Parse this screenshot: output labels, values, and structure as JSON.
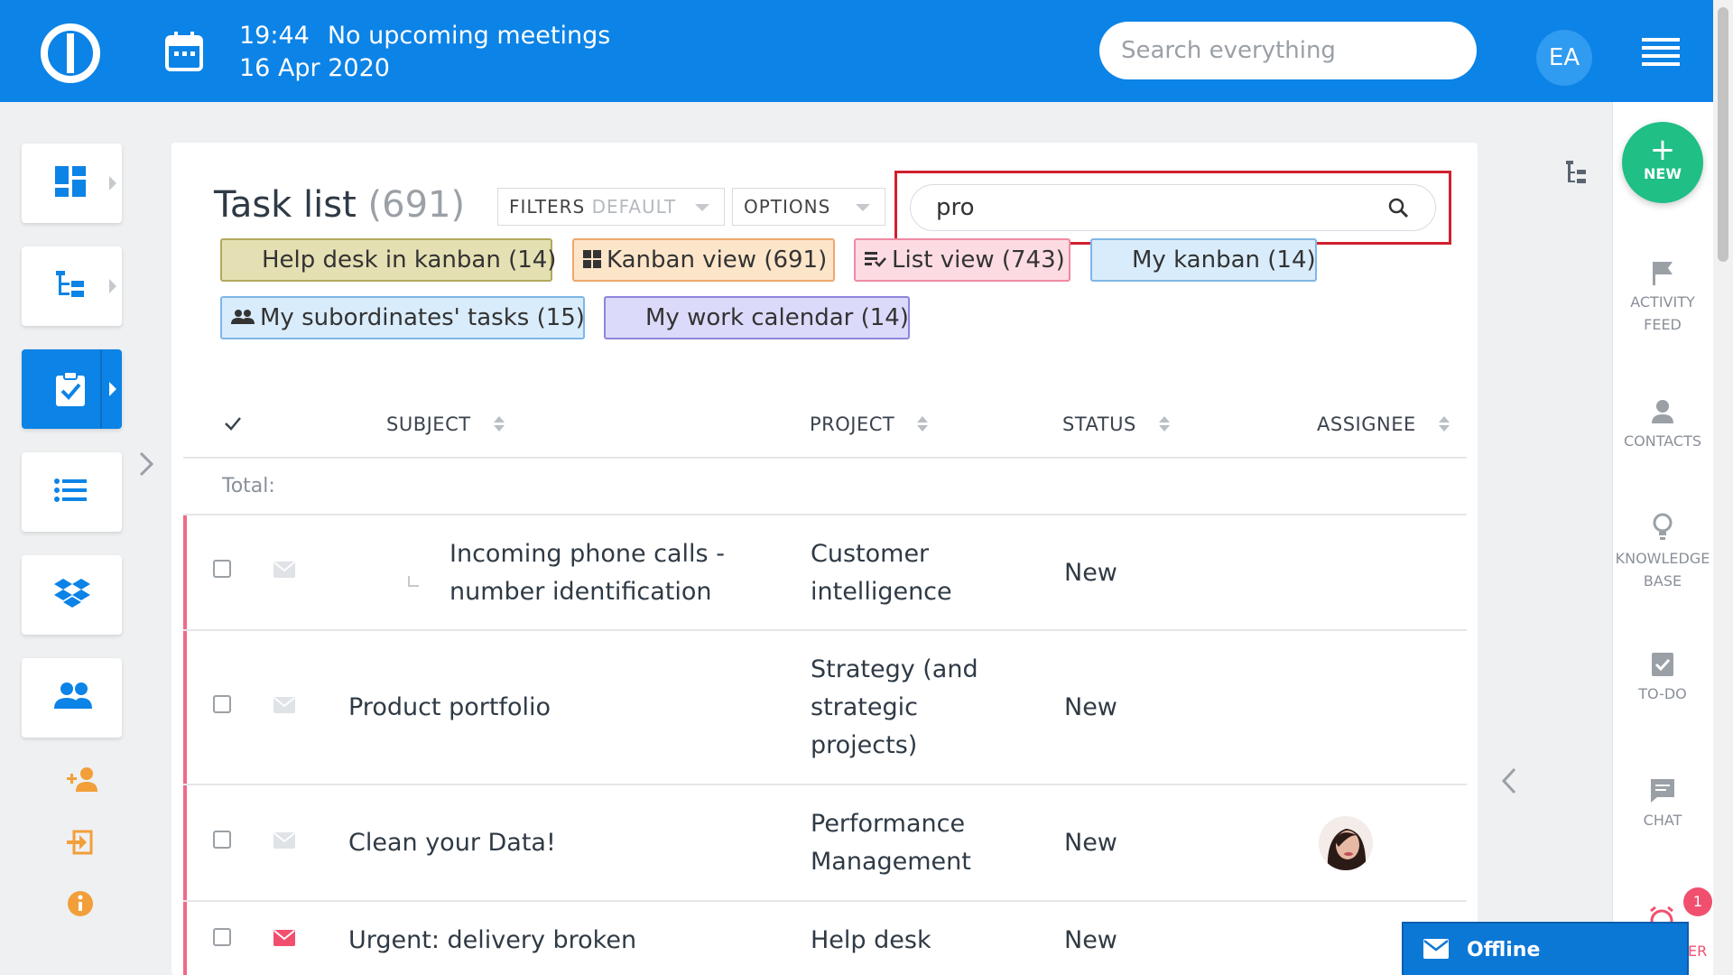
{
  "header": {
    "time": "19:44",
    "meetings": "No upcoming meetings",
    "date": "16 Apr 2020",
    "search_placeholder": "Search everything",
    "user_initials": "EA"
  },
  "left_nav": {
    "items": [
      "dashboard-icon",
      "structure-icon",
      "tasks-icon",
      "list-icon",
      "dropbox-icon",
      "users-icon"
    ],
    "small_actions": [
      "add-user-icon",
      "login-icon",
      "info-icon"
    ]
  },
  "right_sidebar": {
    "new_label": "NEW",
    "items": [
      {
        "line1": "ACTIVITY",
        "line2": "FEED"
      },
      {
        "line1": "CONTACTS",
        "line2": ""
      },
      {
        "line1": "KNOWLEDGE",
        "line2": "BASE"
      },
      {
        "line1": "TO-DO",
        "line2": ""
      },
      {
        "line1": "CHAT",
        "line2": ""
      }
    ],
    "notification_count": "1",
    "reminder_partial": "ER"
  },
  "task_list": {
    "title": "Task list",
    "count": "(691)",
    "filters_label": "FILTERS",
    "filters_value": "DEFAULT",
    "options_label": "OPTIONS",
    "search_value": "pro"
  },
  "saved_queries": [
    {
      "label": "Help desk in kanban (14)",
      "icon": "",
      "color": "#e5e0b3",
      "border": "#b2a85e"
    },
    {
      "label": "Kanban view (691)",
      "icon": "grid-icon",
      "color": "#fde5c9",
      "border": "#f0a86a"
    },
    {
      "label": "List view (743)",
      "icon": "list-check-icon",
      "color": "#fddbe3",
      "border": "#f08aa3"
    },
    {
      "label": "My kanban (14)",
      "icon": "",
      "color": "#d9ecfb",
      "border": "#7fb6e6"
    },
    {
      "label": "My subordinates' tasks (15)",
      "icon": "group-icon",
      "color": "#d9ecfb",
      "border": "#7fb6e6"
    },
    {
      "label": "My work calendar (14)",
      "icon": "",
      "color": "#dcdafa",
      "border": "#8c86dc"
    }
  ],
  "table": {
    "columns": {
      "subject": "SUBJECT",
      "project": "PROJECT",
      "status": "STATUS",
      "assignee": "ASSIGNEE"
    },
    "total_label": "Total:",
    "rows": [
      {
        "subject_l1": "Incoming phone calls -",
        "subject_l2": "number identification",
        "project_l1": "Customer",
        "project_l2": "intelligence",
        "project_l3": "",
        "status": "New"
      },
      {
        "subject_l1": "Product portfolio",
        "subject_l2": "",
        "project_l1": "Strategy (and",
        "project_l2": "strategic",
        "project_l3": "projects)",
        "status": "New"
      },
      {
        "subject_l1": "Clean your Data!",
        "subject_l2": "",
        "project_l1": "Performance",
        "project_l2": "Management",
        "project_l3": "",
        "status": "New"
      },
      {
        "subject_l1": "Urgent: delivery broken",
        "subject_l2": "",
        "project_l1": "Help desk",
        "project_l2": "",
        "project_l3": "",
        "status": "New"
      }
    ]
  },
  "chat": {
    "status_label": "Offline"
  },
  "colors": {
    "brand": "#0c83e6",
    "new_button": "#1fbf86",
    "urgent_mail": "#f0506e",
    "row_accent": "#f06a86",
    "highlight_box": "#d0202f"
  }
}
